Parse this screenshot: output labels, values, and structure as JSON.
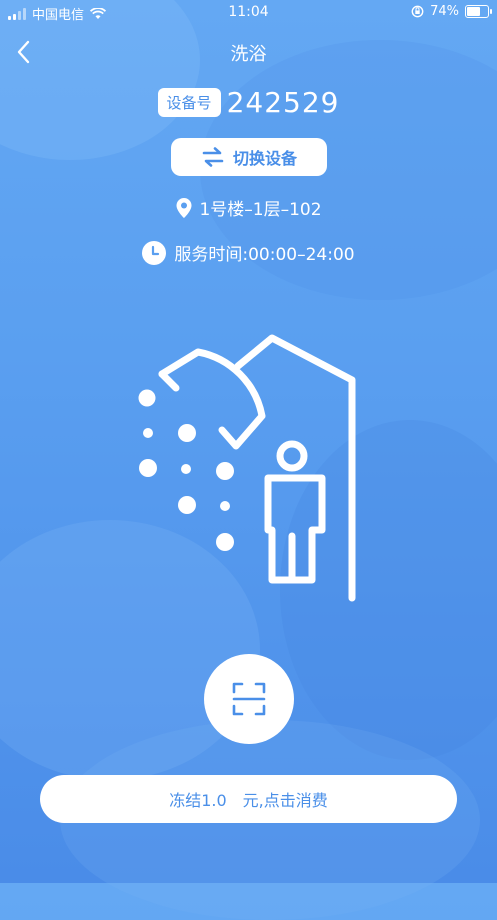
{
  "status_bar": {
    "carrier": "中国电信",
    "time": "11:04",
    "battery": "74%",
    "battery_level": 0.74
  },
  "nav": {
    "title": "洗浴"
  },
  "device": {
    "label": "设备号",
    "number": "242529"
  },
  "switch_button": {
    "label": "切换设备"
  },
  "location": {
    "text": "1号楼–1层–102"
  },
  "service": {
    "text": "服务时间:00:00–24:00"
  },
  "scan_button": {
    "icon": "scan-icon"
  },
  "pay_button": {
    "label": "冻结1.0　元,点击消费"
  },
  "colors": {
    "accent": "#4a8fe8",
    "background": "#5a9ff0"
  }
}
